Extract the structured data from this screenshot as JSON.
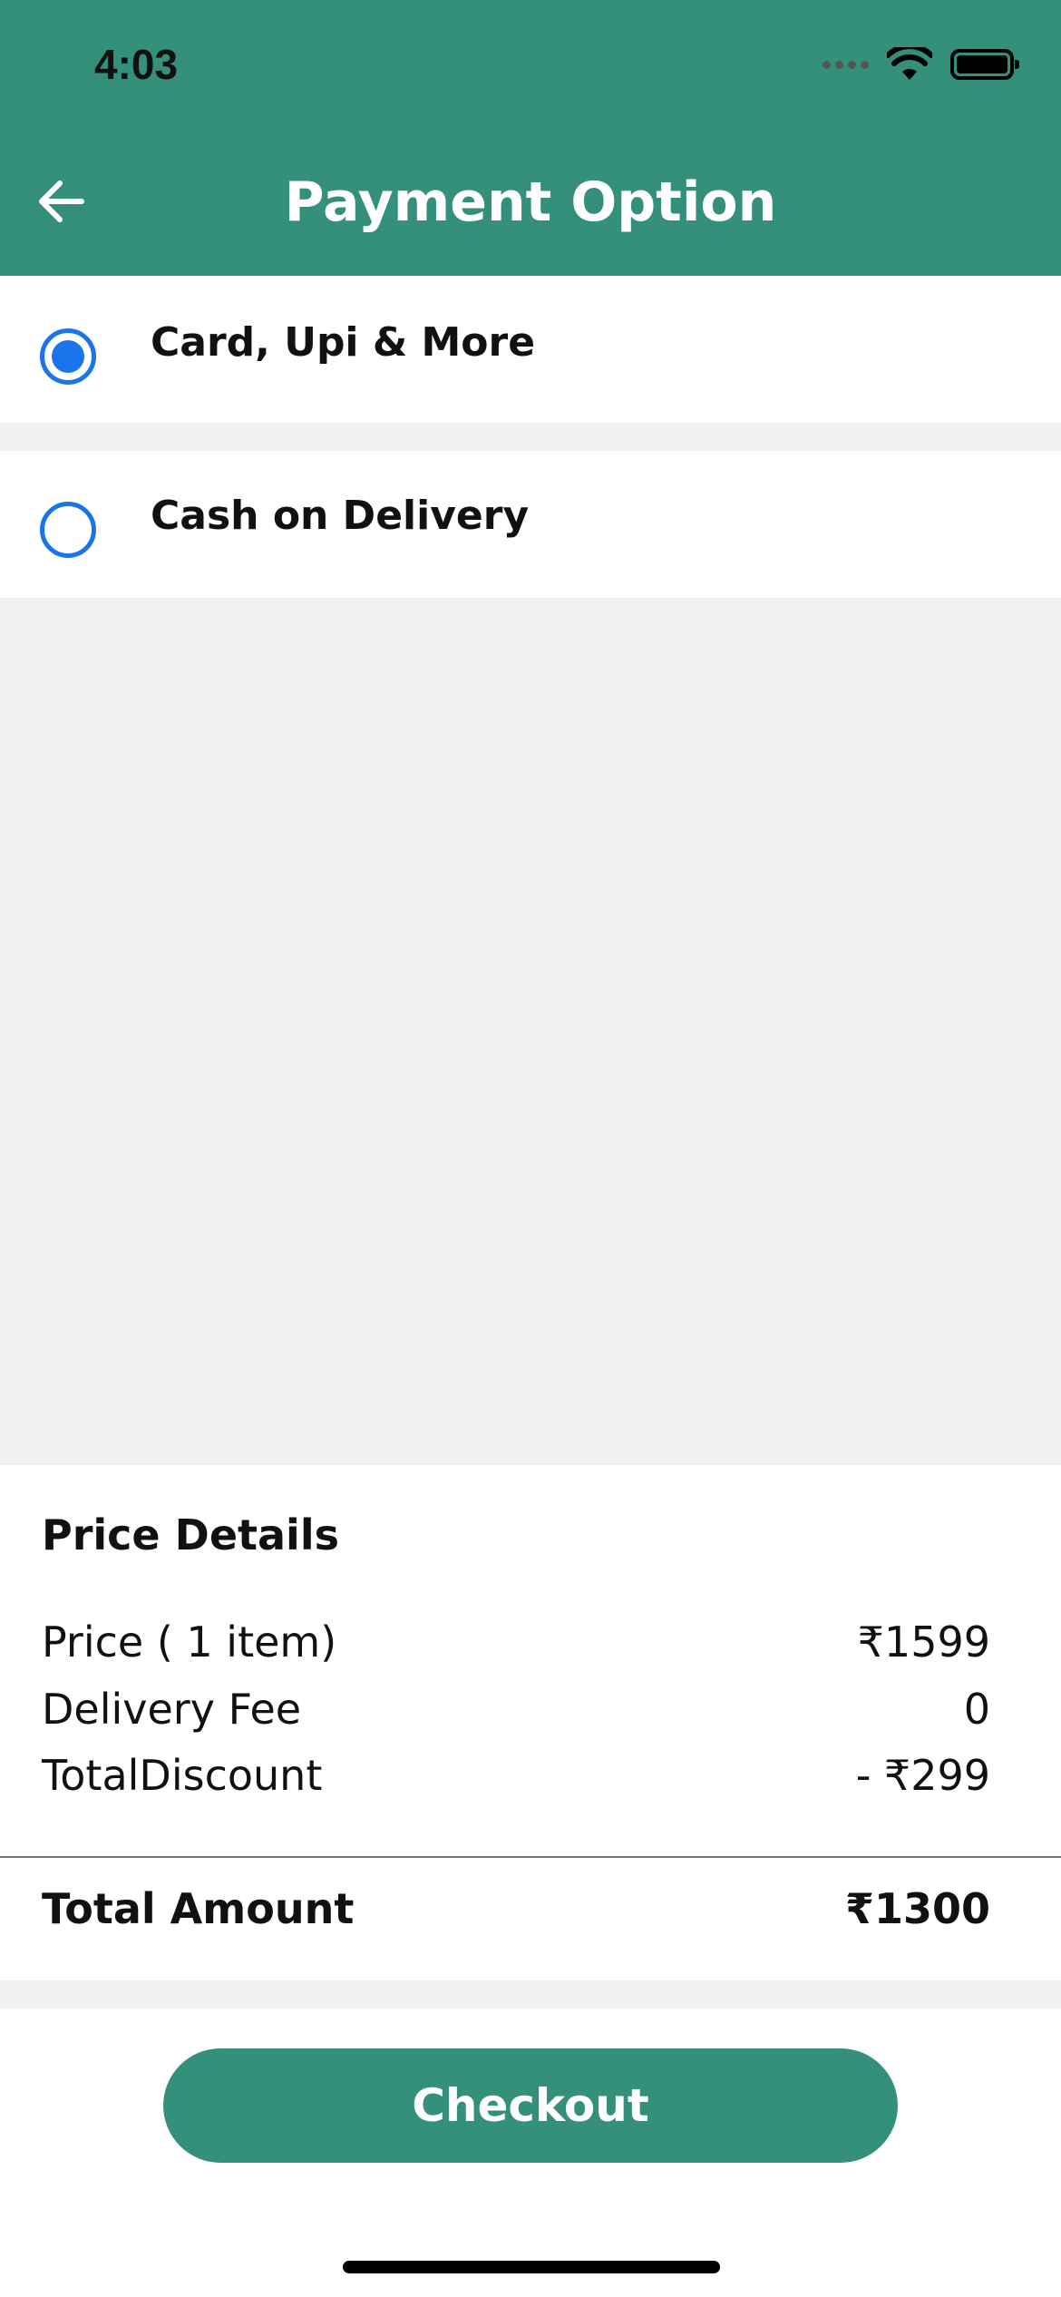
{
  "status_bar": {
    "time": "4:03",
    "icons": [
      "signal-icon",
      "wifi-icon",
      "battery-icon"
    ]
  },
  "header": {
    "title": "Payment Option",
    "back_icon": "arrow-left-icon",
    "background_color": "#35907b"
  },
  "payment_options": [
    {
      "label": "Card, Upi & More",
      "selected": true
    },
    {
      "label": "Cash on Delivery",
      "selected": false
    }
  ],
  "price_details": {
    "title": "Price Details",
    "rows": [
      {
        "label": "Price ( 1 item)",
        "value": "₹1599"
      },
      {
        "label": "Delivery Fee",
        "value": "0"
      },
      {
        "label": "TotalDiscount",
        "value": "- ₹299"
      }
    ],
    "total": {
      "label": "Total Amount",
      "value": "₹1300"
    }
  },
  "checkout": {
    "label": "Checkout",
    "color": "#35907b"
  },
  "accent_color": "#1a75ea"
}
